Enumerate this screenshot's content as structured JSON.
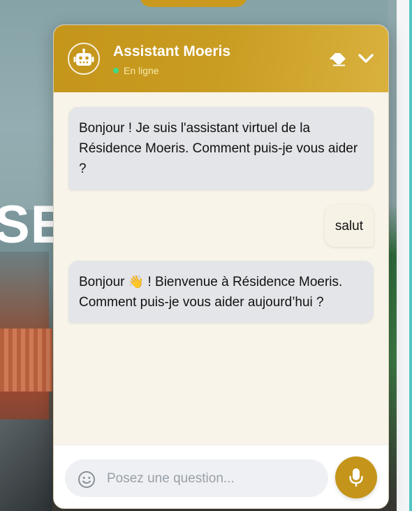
{
  "background": {
    "hero_text": "SE"
  },
  "chat": {
    "title": "Assistant Moeris",
    "status": "En ligne",
    "header_icons": {
      "avatar": "robot-icon",
      "clear": "eraser-icon",
      "collapse": "chevron-down-icon"
    },
    "messages": [
      {
        "role": "bot",
        "text": "Bonjour ! Je suis l'assistant virtuel de la Résidence Moeris. Comment puis-je vous aider ?"
      },
      {
        "role": "user",
        "text": "salut"
      },
      {
        "role": "bot",
        "text_before": "Bonjour ",
        "emoji": "👋",
        "text_after": " ! Bienvenue à Résidence Moeris. Comment puis-je vous aider aujourd’hui ?"
      }
    ],
    "input": {
      "placeholder": "Posez une question...",
      "value": ""
    },
    "footer_icons": {
      "emoji": "smiley-icon",
      "mic": "microphone-icon"
    }
  },
  "colors": {
    "accent": "#c4951a",
    "status_online": "#3ddc84",
    "bot_bubble": "#e4e5e8",
    "chat_bg": "#f8f4e9"
  }
}
